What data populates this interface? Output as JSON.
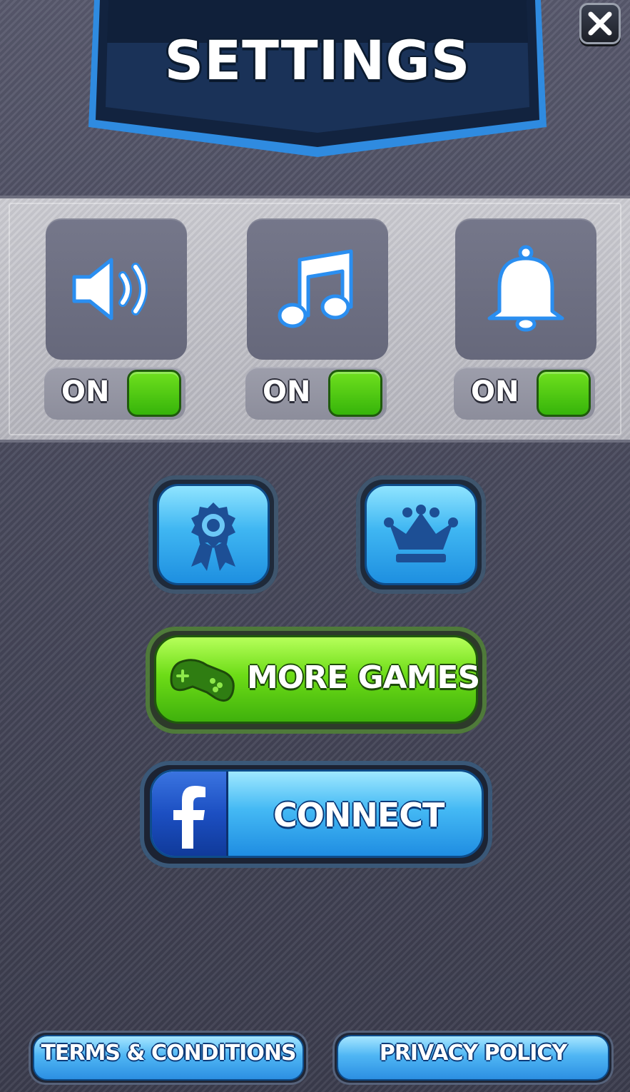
{
  "header": {
    "title": "SETTINGS",
    "close_icon": "close-x-icon"
  },
  "toggles": [
    {
      "id": "sound",
      "icon": "speaker-icon",
      "state_label": "ON",
      "enabled": true
    },
    {
      "id": "music",
      "icon": "music-note-icon",
      "state_label": "ON",
      "enabled": true
    },
    {
      "id": "notifications",
      "icon": "bell-icon",
      "state_label": "ON",
      "enabled": true
    }
  ],
  "icon_buttons": [
    {
      "id": "achievements",
      "icon": "award-ribbon-icon"
    },
    {
      "id": "leaderboard",
      "icon": "crown-icon"
    }
  ],
  "more_games": {
    "label": "MORE GAMES",
    "icon": "gamepad-icon"
  },
  "facebook": {
    "label": "CONNECT",
    "icon": "facebook-f-icon"
  },
  "footer": {
    "terms_label": "TERMS & CONDITIONS",
    "privacy_label": "PRIVACY POLICY"
  },
  "colors": {
    "toggle_on": "#4cc612",
    "accent_blue": "#3fb6f2",
    "accent_green": "#6ddc17",
    "banner_navy": "#14284a"
  }
}
